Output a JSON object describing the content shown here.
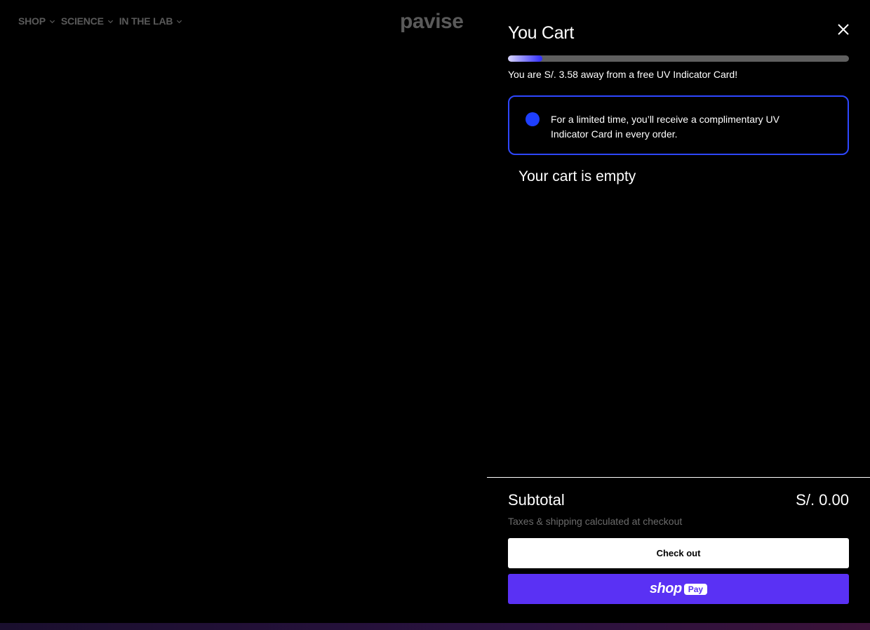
{
  "nav": {
    "items": [
      {
        "label": "SHOP"
      },
      {
        "label": "SCIENCE"
      },
      {
        "label": "IN THE LAB"
      }
    ],
    "logo": "pavise"
  },
  "cart": {
    "title": "You Cart",
    "progress_fraction": 0.1,
    "progress_text": "You are S/. 3.58 away from a free UV Indicator Card!",
    "promo_text": "For a limited time, you’ll receive a complimentary UV Indicator Card in every order.",
    "empty_text": "Your cart is empty",
    "subtotal_label": "Subtotal",
    "subtotal_value": "S/. 0.00",
    "tax_note": "Taxes & shipping calculated at checkout",
    "checkout_label": "Check out",
    "shoppay": {
      "shop": "shop",
      "pay": "Pay"
    }
  },
  "colors": {
    "accent_blue": "#2e47ff",
    "shoppay_purple": "#5a31f4",
    "nav_gray": "#5a5a5a"
  },
  "icons": [
    "chevron-down-icon",
    "close-icon"
  ]
}
